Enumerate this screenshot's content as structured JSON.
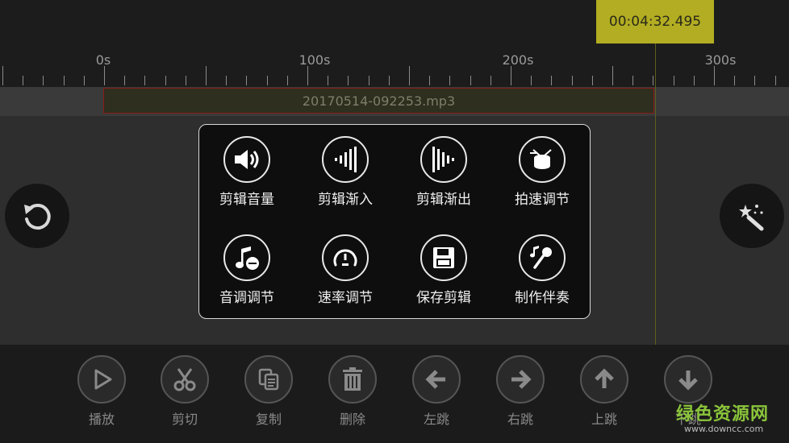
{
  "header": {
    "timecode": "00:04:32.495"
  },
  "ruler": {
    "labels": [
      "0s",
      "100s",
      "200s",
      "300s"
    ]
  },
  "clip": {
    "filename": "20170514-092253.mp3"
  },
  "side_buttons": {
    "left_icon": "undo-icon",
    "right_icon": "magic-wand-icon"
  },
  "menu": {
    "items": [
      {
        "label": "剪辑音量",
        "icon": "volume-icon"
      },
      {
        "label": "剪辑渐入",
        "icon": "fade-in-icon"
      },
      {
        "label": "剪辑渐出",
        "icon": "fade-out-icon"
      },
      {
        "label": "拍速调节",
        "icon": "drum-icon"
      },
      {
        "label": "音调调节",
        "icon": "pitch-icon"
      },
      {
        "label": "速率调节",
        "icon": "speedometer-icon"
      },
      {
        "label": "保存剪辑",
        "icon": "save-icon"
      },
      {
        "label": "制作伴奏",
        "icon": "microphone-icon"
      }
    ]
  },
  "toolbar": {
    "items": [
      {
        "label": "播放",
        "icon": "play-icon"
      },
      {
        "label": "剪切",
        "icon": "scissors-icon"
      },
      {
        "label": "复制",
        "icon": "copy-icon"
      },
      {
        "label": "删除",
        "icon": "trash-icon"
      },
      {
        "label": "左跳",
        "icon": "arrow-left-icon"
      },
      {
        "label": "右跳",
        "icon": "arrow-right-icon"
      },
      {
        "label": "上跳",
        "icon": "arrow-up-icon"
      },
      {
        "label": "下跳",
        "icon": "arrow-down-icon"
      }
    ]
  },
  "watermark": {
    "title": "绿色资源网",
    "url": "www.downcc.com"
  },
  "colors": {
    "timecode_bg": "#b2ad22",
    "clip_border": "#8a1a1a",
    "watermark_green": "#8ac43a"
  }
}
